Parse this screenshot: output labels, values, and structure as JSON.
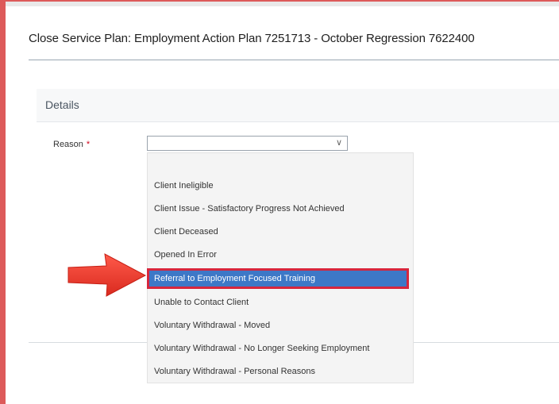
{
  "dialog": {
    "title": "Close Service Plan: Employment Action Plan 7251713 - October Regression 7622400"
  },
  "details_section": {
    "title": "Details"
  },
  "reason_field": {
    "label": "Reason",
    "required_marker": "*",
    "value": ""
  },
  "dropdown": {
    "options": [
      "",
      "Client Ineligible",
      "Client Issue - Satisfactory Progress Not Achieved",
      "Client Deceased",
      "Opened In Error",
      "Referral to Employment Focused Training",
      "Unable to Contact Client",
      "Voluntary Withdrawal - Moved",
      "Voluntary Withdrawal - No Longer Seeking Employment",
      "Voluntary Withdrawal - Personal Reasons"
    ],
    "highlighted_option": "Referral to Employment Focused Training"
  },
  "colors": {
    "highlight": "#3d78c7",
    "annotation": "#d7263d",
    "required": "#d0021b"
  },
  "icons": {
    "select_caret": "chevron-down-icon",
    "callout_arrow": "arrow-right-icon"
  }
}
